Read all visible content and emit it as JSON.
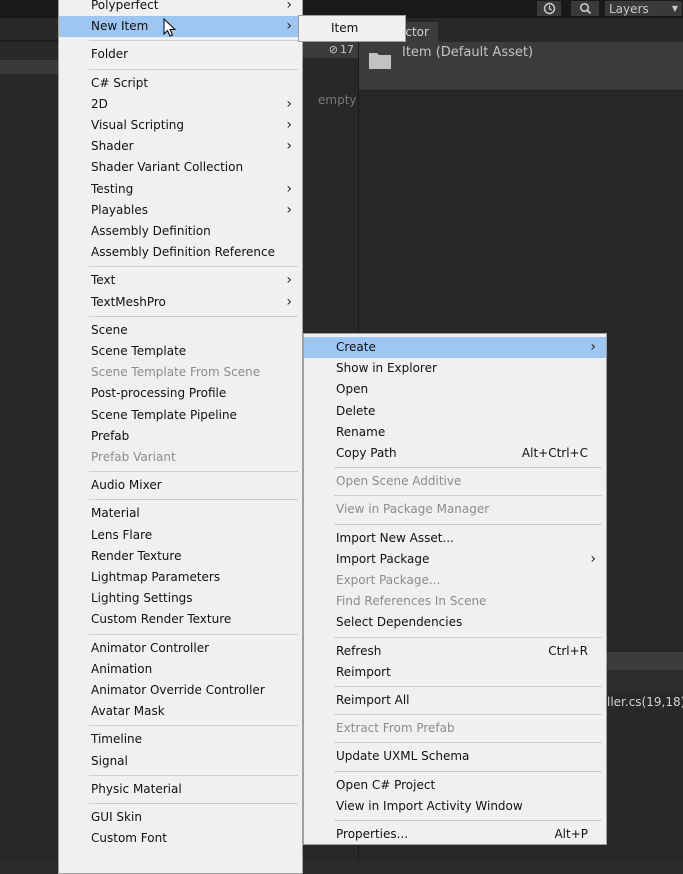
{
  "toolbar": {
    "history_icon": "history-icon",
    "search_icon": "search-icon",
    "layers_label": "Layers"
  },
  "panels": {
    "hierarchy_count": "17",
    "hierarchy_empty": "empty",
    "inspector_tab": "ector",
    "inspector_title": "Item (Default Asset)",
    "console_text": "ller.cs(19,18): "
  },
  "create_menu": {
    "items": [
      {
        "label": "Polyperfect",
        "arrow": true
      },
      {
        "label": "New Item",
        "arrow": true,
        "highlighted": true
      },
      {
        "label": "Folder",
        "sep_before": true
      },
      {
        "label": "C# Script",
        "sep_before": true
      },
      {
        "label": "2D",
        "arrow": true
      },
      {
        "label": "Visual Scripting",
        "arrow": true
      },
      {
        "label": "Shader",
        "arrow": true
      },
      {
        "label": "Shader Variant Collection"
      },
      {
        "label": "Testing",
        "arrow": true
      },
      {
        "label": "Playables",
        "arrow": true
      },
      {
        "label": "Assembly Definition"
      },
      {
        "label": "Assembly Definition Reference"
      },
      {
        "label": "Text",
        "arrow": true,
        "sep_before": true
      },
      {
        "label": "TextMeshPro",
        "arrow": true
      },
      {
        "label": "Scene",
        "sep_before": true
      },
      {
        "label": "Scene Template"
      },
      {
        "label": "Scene Template From Scene",
        "disabled": true
      },
      {
        "label": "Post-processing Profile"
      },
      {
        "label": "Scene Template Pipeline"
      },
      {
        "label": "Prefab"
      },
      {
        "label": "Prefab Variant",
        "disabled": true
      },
      {
        "label": "Audio Mixer",
        "sep_before": true
      },
      {
        "label": "Material",
        "sep_before": true
      },
      {
        "label": "Lens Flare"
      },
      {
        "label": "Render Texture"
      },
      {
        "label": "Lightmap Parameters"
      },
      {
        "label": "Lighting Settings"
      },
      {
        "label": "Custom Render Texture"
      },
      {
        "label": "Animator Controller",
        "sep_before": true
      },
      {
        "label": "Animation"
      },
      {
        "label": "Animator Override Controller"
      },
      {
        "label": "Avatar Mask"
      },
      {
        "label": "Timeline",
        "sep_before": true
      },
      {
        "label": "Signal"
      },
      {
        "label": "Physic Material",
        "sep_before": true
      },
      {
        "label": "GUI Skin",
        "sep_before": true
      },
      {
        "label": "Custom Font"
      }
    ]
  },
  "new_item_submenu": {
    "items": [
      {
        "label": "Item"
      }
    ]
  },
  "context_menu": {
    "items": [
      {
        "label": "Create",
        "arrow": true,
        "highlighted": true
      },
      {
        "label": "Show in Explorer"
      },
      {
        "label": "Open"
      },
      {
        "label": "Delete"
      },
      {
        "label": "Rename"
      },
      {
        "label": "Copy Path",
        "shortcut": "Alt+Ctrl+C"
      },
      {
        "label": "Open Scene Additive",
        "disabled": true,
        "sep_before": true
      },
      {
        "label": "View in Package Manager",
        "disabled": true,
        "sep_before": true
      },
      {
        "label": "Import New Asset...",
        "sep_before": true
      },
      {
        "label": "Import Package",
        "arrow": true
      },
      {
        "label": "Export Package...",
        "disabled": true
      },
      {
        "label": "Find References In Scene",
        "disabled": true
      },
      {
        "label": "Select Dependencies"
      },
      {
        "label": "Refresh",
        "shortcut": "Ctrl+R",
        "sep_before": true
      },
      {
        "label": "Reimport"
      },
      {
        "label": "Reimport All",
        "sep_before": true
      },
      {
        "label": "Extract From Prefab",
        "disabled": true,
        "sep_before": true
      },
      {
        "label": "Update UXML Schema",
        "sep_before": true
      },
      {
        "label": "Open C# Project",
        "sep_before": true
      },
      {
        "label": "View in Import Activity Window"
      },
      {
        "label": "Properties...",
        "shortcut": "Alt+P",
        "sep_before": true
      }
    ]
  }
}
